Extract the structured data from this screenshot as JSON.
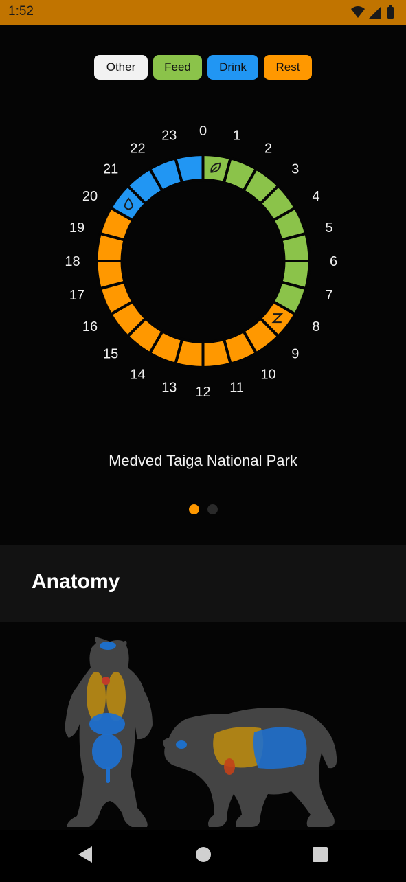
{
  "status_bar": {
    "time": "1:52",
    "icons": [
      "wifi-icon",
      "signal-icon",
      "battery-icon"
    ]
  },
  "legend": [
    {
      "label": "Other",
      "color": "#f2f2f2"
    },
    {
      "label": "Feed",
      "color": "#8bc34a"
    },
    {
      "label": "Drink",
      "color": "#2196f3"
    },
    {
      "label": "Rest",
      "color": "#ff9800"
    }
  ],
  "activity_clock": {
    "hour_labels": [
      "0",
      "1",
      "2",
      "3",
      "4",
      "5",
      "6",
      "7",
      "8",
      "9",
      "10",
      "11",
      "12",
      "13",
      "14",
      "15",
      "16",
      "17",
      "18",
      "19",
      "20",
      "21",
      "22",
      "23"
    ],
    "hours": [
      "Feed",
      "Feed",
      "Feed",
      "Feed",
      "Feed",
      "Feed",
      "Feed",
      "Feed",
      "Rest",
      "Rest",
      "Rest",
      "Rest",
      "Rest",
      "Rest",
      "Rest",
      "Rest",
      "Rest",
      "Rest",
      "Rest",
      "Rest",
      "Drink",
      "Drink",
      "Drink",
      "Drink"
    ],
    "icons": {
      "0": "leaf-icon",
      "8": "sleep-z-icon",
      "20": "water-drop-icon"
    }
  },
  "location": "Medved Taiga National Park",
  "pager": {
    "pages": 2,
    "active": 0
  },
  "anatomy": {
    "title": "Anatomy"
  }
}
